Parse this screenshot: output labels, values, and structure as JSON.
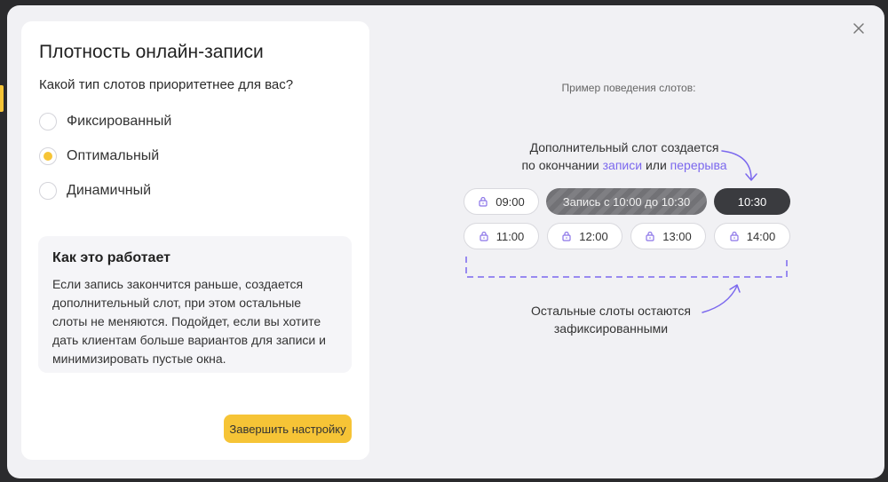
{
  "modal": {
    "title": "Плотность онлайн-записи",
    "question": "Какой тип слотов приоритетнее для вас?",
    "options": [
      {
        "label": "Фиксированный",
        "selected": false
      },
      {
        "label": "Оптимальный",
        "selected": true
      },
      {
        "label": "Динамичный",
        "selected": false
      }
    ],
    "info": {
      "title": "Как это работает",
      "text": "Если запись закончится раньше, создается дополнительный слот, при этом остальные слоты не меняются. Подойдет, если вы хотите дать клиентам больше вариантов для записи и минимизировать пустые окна."
    },
    "finish_label": "Завершить настройку",
    "close_icon": "close-icon"
  },
  "example": {
    "label": "Пример поведения слотов:",
    "annotation_top": {
      "line1": "Дополнительный слот создается",
      "line2_prefix": "по окончании ",
      "link1": "записи",
      "middle": " или ",
      "link2": "перерыва"
    },
    "annotation_bottom": {
      "line1": "Остальные слоты остаются",
      "line2": "зафиксированными"
    },
    "slots_row1": [
      {
        "label": "09:00",
        "style": "light",
        "locked": true
      },
      {
        "label": "Запись с 10:00 до 10:30",
        "style": "booked",
        "locked": false
      },
      {
        "label": "10:30",
        "style": "dark",
        "locked": false
      }
    ],
    "slots_row2": [
      {
        "label": "11:00",
        "style": "light",
        "locked": true
      },
      {
        "label": "12:00",
        "style": "light",
        "locked": true
      },
      {
        "label": "13:00",
        "style": "light",
        "locked": true
      },
      {
        "label": "14:00",
        "style": "light",
        "locked": true
      }
    ]
  },
  "colors": {
    "accent": "#f6c436",
    "link": "#7b68ee",
    "dark_slot": "#3a3b3f",
    "booked_slot": "#7f7f83"
  }
}
